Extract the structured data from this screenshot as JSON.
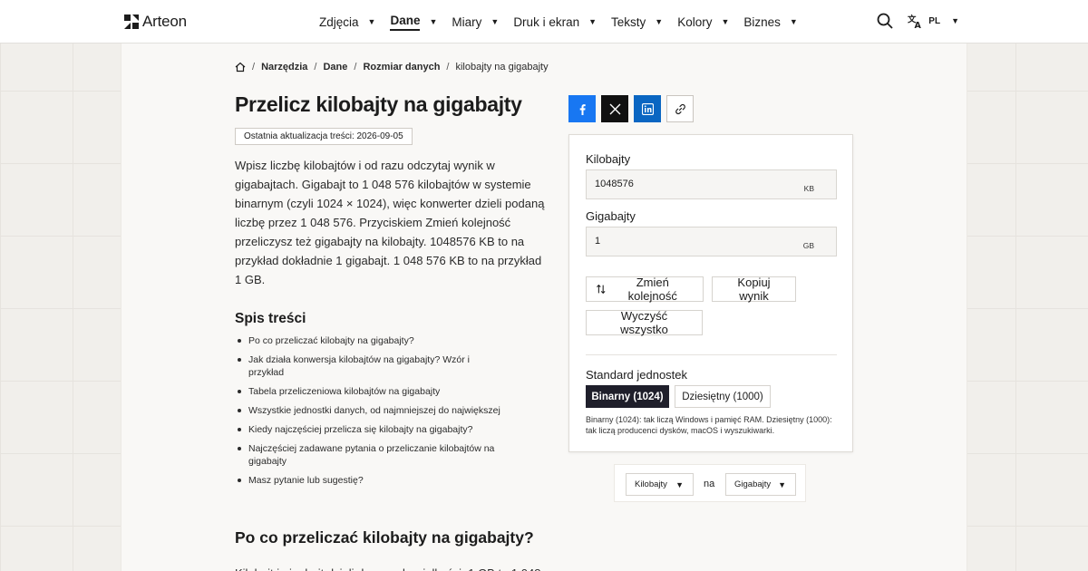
{
  "brand": {
    "name": "Arteon"
  },
  "nav": [
    {
      "label": "Zdjęcia",
      "active": false
    },
    {
      "label": "Dane",
      "active": true
    },
    {
      "label": "Miary",
      "active": false
    },
    {
      "label": "Druk i ekran",
      "active": false
    },
    {
      "label": "Teksty",
      "active": false
    },
    {
      "label": "Kolory",
      "active": false
    },
    {
      "label": "Biznes",
      "active": false
    }
  ],
  "header": {
    "lang": "PL"
  },
  "breadcrumb": {
    "items": [
      "Narzędzia",
      "Dane",
      "Rozmiar danych"
    ],
    "current": "kilobajty na gigabajty"
  },
  "page": {
    "title": "Przelicz kilobajty na gigabajty",
    "updated": "Ostatnia aktualizacja treści: 2026-09-05",
    "intro": "Wpisz liczbę kilobajtów i od razu odczytaj wynik w gigabajtach. Gigabajt to 1 048 576 kilobajtów w systemie binarnym (czyli 1024 × 1024), więc konwerter dzieli podaną liczbę przez 1 048 576. Przyciskiem Zmień kolejność przeliczysz też gigabajty na kilobajty. 1048576 KB to na przykład dokładnie 1 gigabajt. 1 048 576 KB to na przykład 1 GB."
  },
  "toc": {
    "title": "Spis treści",
    "items": [
      "Po co przeliczać kilobajty na gigabajty?",
      "Jak działa konwersja kilobajtów na gigabajty? Wzór i przykład",
      "Tabela przeliczeniowa kilobajtów na gigabajty",
      "Wszystkie jednostki danych, od najmniejszej do największej",
      "Kiedy najczęściej przelicza się kilobajty na gigabajty?",
      "Najczęściej zadawane pytania o przeliczanie kilobajtów na gigabajty",
      "Masz pytanie lub sugestię?"
    ]
  },
  "section": {
    "title": "Po co przeliczać kilobajty na gigabajty?",
    "text": "Kilobajt i gigabajt dzieli dwa rzędy wielkości: 1 GB to 1 048"
  },
  "converter": {
    "from": {
      "label": "Kilobajty",
      "value": "1048576",
      "unit": "KB"
    },
    "to": {
      "label": "Gigabajty",
      "value": "1",
      "unit": "GB"
    },
    "swap_label": "Zmień kolejność",
    "copy_label": "Kopiuj wynik",
    "clear_label": "Wyczyść wszystko",
    "standard": {
      "label": "Standard jednostek",
      "binary": "Binarny (1024)",
      "decimal": "Dziesiętny (1000)",
      "selected": "binary",
      "note": "Binarny (1024): tak liczą Windows i pamięć RAM. Dziesiętny (1000): tak liczą producenci dysków, macOS i wyszukiwarki."
    }
  },
  "picker": {
    "from": "Kilobajty",
    "connector": "na",
    "to": "Gigabajty"
  },
  "colors": {
    "facebook": "#1877f2",
    "x": "#111111",
    "linkedin": "#0a66c2",
    "segment_active": "#1f1f2b"
  }
}
